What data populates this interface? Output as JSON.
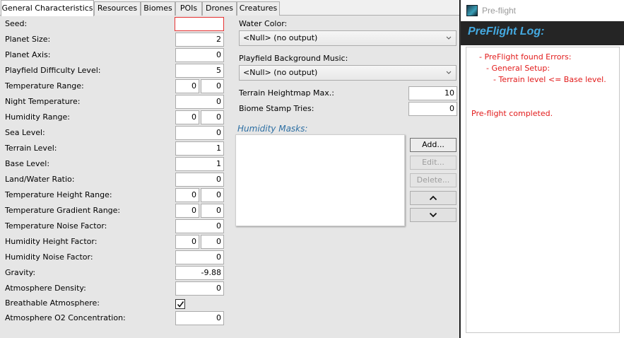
{
  "tabs": [
    "General Characteristics",
    "Resources",
    "Biomes",
    "POIs",
    "Drones",
    "Creatures"
  ],
  "fields": {
    "seed": {
      "label": "Seed:",
      "value": ""
    },
    "planet_size": {
      "label": "Planet Size:",
      "value": "2"
    },
    "planet_axis": {
      "label": "Planet Axis:",
      "value": "0"
    },
    "difficulty": {
      "label": "Playfield Difficulty Level:",
      "value": "5"
    },
    "temperature_range": {
      "label": "Temperature Range:",
      "min": "0",
      "max": "0"
    },
    "night_temperature": {
      "label": "Night Temperature:",
      "value": "0"
    },
    "humidity_range": {
      "label": "Humidity Range:",
      "min": "0",
      "max": "0"
    },
    "sea_level": {
      "label": "Sea Level:",
      "value": "0"
    },
    "terrain_level": {
      "label": "Terrain Level:",
      "value": "1"
    },
    "base_level": {
      "label": "Base Level:",
      "value": "1"
    },
    "land_water_ratio": {
      "label": "Land/Water Ratio:",
      "value": "0"
    },
    "temp_height_range": {
      "label": "Temperature Height Range:",
      "min": "0",
      "max": "0"
    },
    "temp_gradient_range": {
      "label": "Temperature Gradient Range:",
      "min": "0",
      "max": "0"
    },
    "temp_noise_factor": {
      "label": "Temperature Noise Factor:",
      "value": "0"
    },
    "humidity_height_factor": {
      "label": "Humidity Height Factor:",
      "min": "0",
      "max": "0"
    },
    "humidity_noise_factor": {
      "label": "Humidity Noise Factor:",
      "value": "0"
    },
    "gravity": {
      "label": "Gravity:",
      "value": "-9.88"
    },
    "atmosphere_density": {
      "label": "Atmosphere Density:",
      "value": "0"
    },
    "breathable_atmosphere": {
      "label": "Breathable Atmosphere:",
      "checked": true
    },
    "atmosphere_o2": {
      "label": "Atmosphere O2 Concentration:",
      "value": "0"
    }
  },
  "middle": {
    "water_color": {
      "label": "Water Color:",
      "value": "<Null> (no output)"
    },
    "background_music": {
      "label": "Playfield Background Music:",
      "value": "<Null> (no output)"
    },
    "terrain_heightmap_max": {
      "label": "Terrain Heightmap Max.:",
      "value": "10"
    },
    "biome_stamp_tries": {
      "label": "Biome Stamp Tries:",
      "value": "0"
    },
    "humidity_masks_title": "Humidity Masks:",
    "buttons": {
      "add": "Add...",
      "edit": "Edit...",
      "delete": "Delete..."
    }
  },
  "preflight": {
    "window_title": "Pre-flight",
    "header": "PreFlight Log:",
    "log": [
      "- PreFlight found Errors:",
      "- General Setup:",
      "- Terrain level <= Base level.",
      "Pre-flight completed."
    ]
  },
  "colors": {
    "error": "#e21a1a",
    "accent": "#44a9e0",
    "section": "#2d6fa3"
  },
  "icons": [
    "chevron-down-icon",
    "chevron-up-icon",
    "checkmark-icon",
    "app-icon"
  ]
}
